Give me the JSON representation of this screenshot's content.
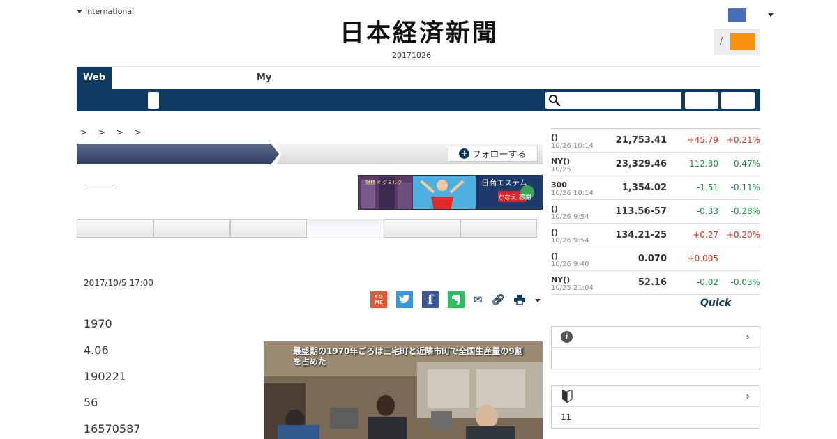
{
  "header": {
    "region_label": "International",
    "logo_text": "日本経済新聞",
    "edition_date": "20171026",
    "login_slash": "/"
  },
  "tabs": {
    "web_label": "Web",
    "my_label": "My"
  },
  "search": {
    "placeholder": ""
  },
  "breadcrumb": "> > > >",
  "section": {
    "follow_label": "フォローする"
  },
  "banner": {
    "left_text": "財務 ✕ グミルク",
    "right_text": "日商エステム",
    "right_sub": "かなえ 感謝"
  },
  "article": {
    "date": "2017/10/5 17:00",
    "paragraphs": [
      "1970",
      "4.06",
      "190221",
      "56",
      "16570587"
    ],
    "photo_caption": "最盛期の1970年ごろは三宅町と近隣市町で全国生産量の9割を占めた"
  },
  "share": {
    "come_label": "COME"
  },
  "market": {
    "rows": [
      {
        "name": "()",
        "time": "10/26 10:14",
        "value": "21,753.41",
        "change": "+45.79",
        "pct": "+0.21%"
      },
      {
        "name": "NY()",
        "time": "10/25",
        "value": "23,329.46",
        "change": "-112.30",
        "pct": "-0.47%"
      },
      {
        "name": "300",
        "time": "10/26 10:14",
        "value": "1,354.02",
        "change": "-1.51",
        "pct": "-0.11%"
      },
      {
        "name": "()",
        "time": "10/26 9:54",
        "value": "113.56-57",
        "change": "-0.33",
        "pct": "-0.28%"
      },
      {
        "name": "()",
        "time": "10/26 9:54",
        "value": "134.21-25",
        "change": "+0.27",
        "pct": "+0.20%"
      },
      {
        "name": "()",
        "time": "10/26 9:40",
        "value": "0.070",
        "change": "+0.005",
        "pct": ""
      },
      {
        "name": "NY()",
        "time": "10/25 21:04",
        "value": "52.16",
        "change": "-0.02",
        "pct": "-0.03%"
      }
    ],
    "provider": "Quick"
  },
  "side": {
    "box2_body": "11"
  },
  "colors": {
    "navy": "#0e3a61",
    "orange": "#f6900d",
    "up": "#d0311f",
    "down": "#168a35"
  }
}
